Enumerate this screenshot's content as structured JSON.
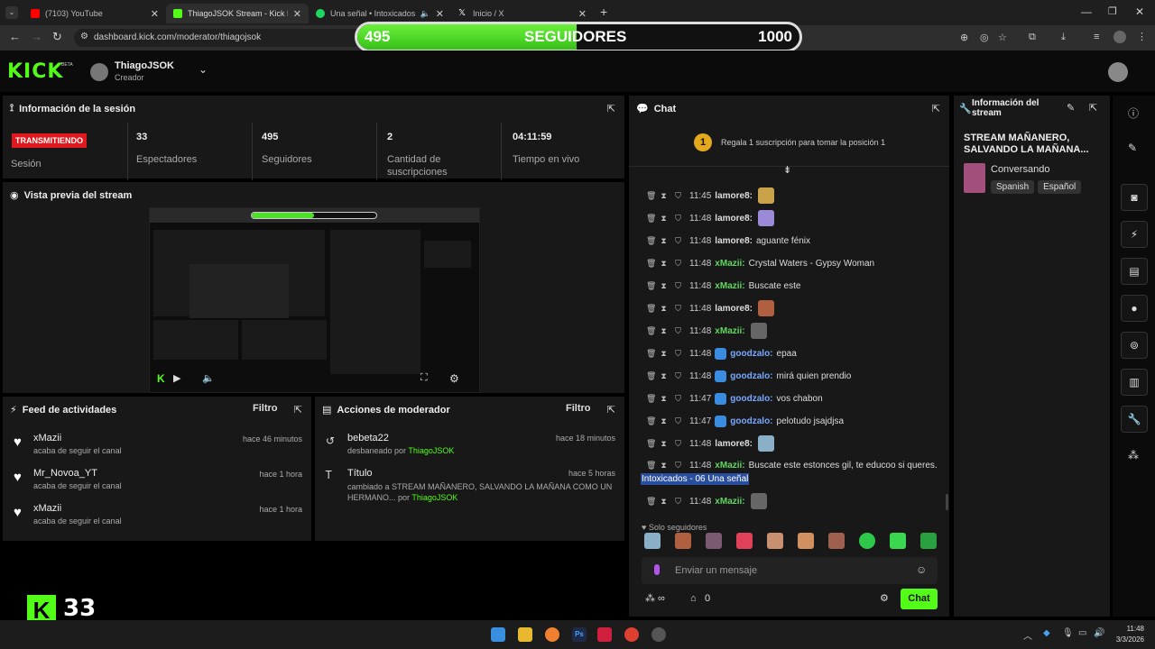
{
  "browser": {
    "tabs": [
      {
        "label": "(7103) YouTube",
        "color": "#ff0000"
      },
      {
        "label": "ThiagoJSOK Stream - Kick Dash",
        "color": "#53fc18"
      },
      {
        "label": "Una señal • Intoxicados",
        "color": "#1ed760"
      },
      {
        "label": "Inicio / X",
        "color": "#ffffff"
      }
    ],
    "url": "dashboard.kick.com/moderator/thiagojsok"
  },
  "followers_bar": {
    "current": "495",
    "label": "SEGUIDORES",
    "goal": "1000",
    "progress": 0.495
  },
  "header": {
    "logo": "KICK",
    "beta": "BETA",
    "user": "ThiagoJSOK",
    "role": "Creador"
  },
  "session": {
    "title": "Información de la sesión",
    "status_badge": "TRANSMITIENDO",
    "status_label": "Sesión",
    "viewers": "33",
    "viewers_label": "Espectadores",
    "followers": "495",
    "followers_label": "Seguidores",
    "subs": "2",
    "subs_label": "Cantidad de suscripciones",
    "uptime": "04:11:59",
    "uptime_label": "Tiempo en vivo"
  },
  "preview": {
    "title": "Vista previa del stream"
  },
  "feed": {
    "title": "Feed de actividades",
    "filter": "Filtro",
    "items": [
      {
        "name": "xMazii",
        "desc": "acaba de seguir el canal",
        "time": "hace 46 minutos"
      },
      {
        "name": "Mr_Novoa_YT",
        "desc": "acaba de seguir el canal",
        "time": "hace 1 hora"
      },
      {
        "name": "xMazii",
        "desc": "acaba de seguir el canal",
        "time": "hace 1 hora"
      }
    ]
  },
  "modactions": {
    "title": "Acciones de moderador",
    "filter": "Filtro",
    "items": [
      {
        "name": "bebeta22",
        "desc": "desbaneado por",
        "by": "ThiagoJSOK",
        "time": "hace 18 minutos"
      },
      {
        "name": "Título",
        "desc": "cambiado a STREAM MAÑANERO, SALVANDO LA MAÑANA COMO UN HERMANO... por",
        "by": "ThiagoJSOK",
        "time": "hace 5 horas"
      }
    ]
  },
  "chat": {
    "title": "Chat",
    "gift_rank": "1",
    "gift_text": "Regala 1 suscripción para tomar la posición 1",
    "messages": [
      {
        "time": "11:45",
        "user": "lamore8:",
        "color": "w",
        "text": "",
        "emote": "#c9a24a"
      },
      {
        "time": "11:48",
        "user": "lamore8:",
        "color": "w",
        "text": "",
        "emote": "#9b8ad8"
      },
      {
        "time": "11:48",
        "user": "lamore8:",
        "color": "w",
        "text": "aguante fénix",
        "emote": ""
      },
      {
        "time": "11:48",
        "user": "xMazii:",
        "color": "g",
        "text": "Crystal Waters - Gypsy Woman",
        "emote": ""
      },
      {
        "time": "11:48",
        "user": "xMazii:",
        "color": "g",
        "text": "Buscate este",
        "emote": ""
      },
      {
        "time": "11:48",
        "user": "lamore8:",
        "color": "w",
        "text": "",
        "emote": "#b06040"
      },
      {
        "time": "11:48",
        "user": "xMazii:",
        "color": "g",
        "text": "",
        "emote": "#666666"
      },
      {
        "time": "11:48",
        "user": "goodzalo:",
        "color": "b",
        "text": "epaa",
        "emote": ""
      },
      {
        "time": "11:48",
        "user": "goodzalo:",
        "color": "b",
        "text": "mirá quien prendio",
        "emote": ""
      },
      {
        "time": "11:47",
        "user": "goodzalo:",
        "color": "b",
        "text": "vos chabon",
        "emote": ""
      },
      {
        "time": "11:47",
        "user": "goodzalo:",
        "color": "b",
        "text": "pelotudo jsajdjsa",
        "emote": ""
      },
      {
        "time": "11:48",
        "user": "lamore8:",
        "color": "w",
        "text": "",
        "emote": "#8ab0c8"
      },
      {
        "time": "11:48",
        "user": "xMazii:",
        "color": "g",
        "text": "Buscate este estonces gil, te educoo si queres.",
        "emote": ""
      }
    ],
    "highlight": "Intoxicados - 06 Una señal",
    "last_time": "11:48",
    "last_user": "xMazii:",
    "followers_only": "Solo seguidores",
    "input_placeholder": "Enviar un mensaje",
    "points": "0",
    "send": "Chat"
  },
  "streaminfo": {
    "title": "Información del stream",
    "stream_title": "STREAM MAÑANERO, SALVANDO LA MAÑANA...",
    "category": "Conversando",
    "tags": [
      "Spanish",
      "Español"
    ]
  },
  "overlay": {
    "viewers": "33"
  },
  "taskbar": {
    "time": "11:48",
    "date": "3/3/2026"
  }
}
